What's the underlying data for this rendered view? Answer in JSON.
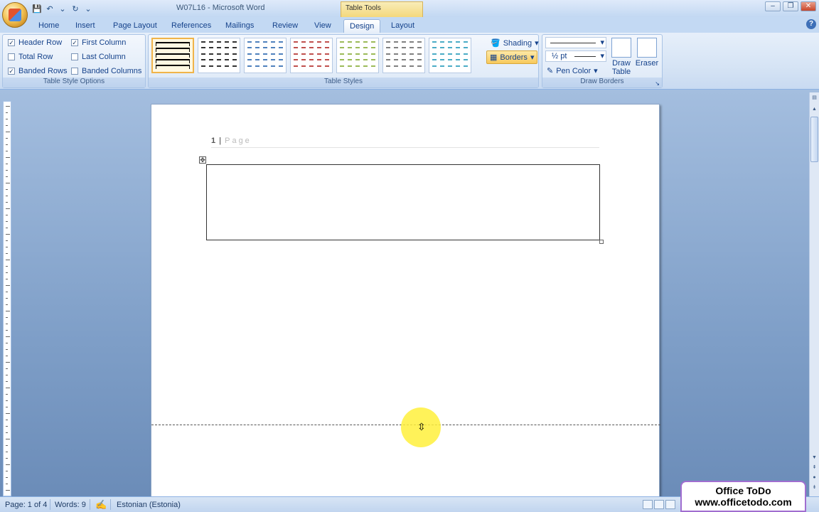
{
  "window": {
    "title": "W07L16 - Microsoft Word",
    "context_tab": "Table Tools",
    "controls": [
      "–",
      "❐",
      "✕"
    ]
  },
  "quick_access": [
    "💾",
    "↶",
    "⌄",
    "↻",
    "⌄"
  ],
  "tabs": [
    {
      "label": "Home"
    },
    {
      "label": "Insert"
    },
    {
      "label": "Page Layout"
    },
    {
      "label": "References"
    },
    {
      "label": "Mailings"
    },
    {
      "label": "Review"
    },
    {
      "label": "View"
    },
    {
      "label": "Design",
      "active": true
    },
    {
      "label": "Layout"
    }
  ],
  "ribbon": {
    "table_style_options": {
      "label": "Table Style Options",
      "options": [
        {
          "label": "Header Row",
          "checked": true
        },
        {
          "label": "First Column",
          "checked": true
        },
        {
          "label": "Total Row",
          "checked": false
        },
        {
          "label": "Last Column",
          "checked": false
        },
        {
          "label": "Banded Rows",
          "checked": true
        },
        {
          "label": "Banded Columns",
          "checked": false
        }
      ]
    },
    "table_styles": {
      "label": "Table Styles",
      "thumb_colors": [
        "#000000",
        "#333333",
        "#4f81bd",
        "#c0504d",
        "#9bbb59",
        "#808080",
        "#4bacc6"
      ]
    },
    "shading_label": "Shading",
    "borders_label": "Borders",
    "draw_borders": {
      "label": "Draw Borders",
      "pen_weight": "½ pt",
      "pen_color_label": "Pen Color",
      "draw_table_label": "Draw Table",
      "eraser_label": "Eraser"
    }
  },
  "document": {
    "header_page_num": "1",
    "header_sep": "|",
    "header_page_word": "Page"
  },
  "status": {
    "page": "Page: 1 of 4",
    "words": "Words: 9",
    "language": "Estonian (Estonia)"
  },
  "brand": {
    "line1": "Office ToDo",
    "line2": "www.officetodo.com"
  },
  "colors": {
    "ribbon_bg": "#dce8f7",
    "accent": "#15428b",
    "highlight": "#f8c95c",
    "cursor_highlight": "#fff03c"
  }
}
